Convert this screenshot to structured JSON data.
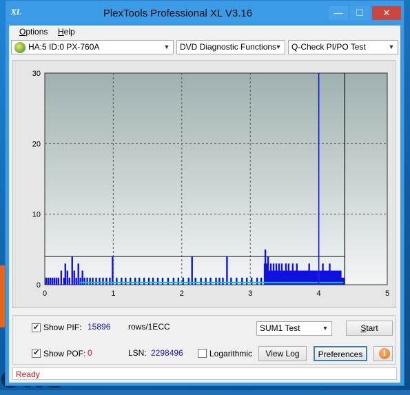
{
  "window": {
    "title": "PlexTools Professional XL V3.16",
    "app_icon": "XL",
    "controls": {
      "minimize": "—",
      "maximize": "☐",
      "close": "✕"
    }
  },
  "menu": {
    "options": {
      "accel": "O",
      "rest": "ptions"
    },
    "help": {
      "accel": "H",
      "rest": "elp"
    }
  },
  "toolbar": {
    "drive": "HA:5 ID:0  PX-760A",
    "function": "DVD Diagnostic Functions",
    "test": "Q-Check PI/PO Test"
  },
  "colors": {
    "pi_series": "#1010e0",
    "po_series": "#00c8c8",
    "plot_top": "#9fb0b0",
    "plot_bottom": "#f4f6f6",
    "status_text": "#e01010"
  },
  "chart_data": {
    "type": "bar",
    "x_ticks": [
      "0",
      "1",
      "2",
      "3",
      "4",
      "5"
    ],
    "y_ticks": [
      "0",
      "10",
      "20",
      "30"
    ],
    "xlim": [
      0,
      5
    ],
    "ylim": [
      0,
      30
    ],
    "grid": true,
    "threshold_line": 4,
    "scan_end_marker": 4.38,
    "highlight_marker": 4.0,
    "series": [
      {
        "points": [
          [
            0.02,
            1
          ],
          [
            0.05,
            1
          ],
          [
            0.08,
            1
          ],
          [
            0.11,
            1
          ],
          [
            0.14,
            1
          ],
          [
            0.17,
            1
          ],
          [
            0.2,
            1
          ],
          [
            0.24,
            2
          ],
          [
            0.28,
            1
          ],
          [
            0.3,
            3
          ],
          [
            0.33,
            2
          ],
          [
            0.36,
            1
          ],
          [
            0.4,
            4
          ],
          [
            0.43,
            2
          ],
          [
            0.46,
            1
          ],
          [
            0.49,
            3
          ],
          [
            0.52,
            1
          ],
          [
            0.55,
            2
          ],
          [
            0.58,
            1
          ],
          [
            0.62,
            1
          ],
          [
            0.66,
            1
          ],
          [
            0.7,
            1
          ],
          [
            0.75,
            1
          ],
          [
            0.8,
            1
          ],
          [
            0.85,
            1
          ],
          [
            0.9,
            1
          ],
          [
            0.95,
            1
          ],
          [
            0.99,
            4
          ],
          [
            1.05,
            1
          ],
          [
            1.12,
            1
          ],
          [
            1.18,
            1
          ],
          [
            1.25,
            1
          ],
          [
            1.32,
            1
          ],
          [
            1.38,
            1
          ],
          [
            1.45,
            1
          ],
          [
            1.52,
            1
          ],
          [
            1.58,
            1
          ],
          [
            1.65,
            1
          ],
          [
            1.72,
            1
          ],
          [
            1.8,
            1
          ],
          [
            1.88,
            1
          ],
          [
            1.95,
            1
          ],
          [
            2.02,
            1
          ],
          [
            2.1,
            1
          ],
          [
            2.15,
            4
          ],
          [
            2.2,
            1
          ],
          [
            2.28,
            1
          ],
          [
            2.35,
            1
          ],
          [
            2.42,
            1
          ],
          [
            2.5,
            1
          ],
          [
            2.55,
            1
          ],
          [
            2.6,
            1
          ],
          [
            2.66,
            4
          ],
          [
            2.72,
            1
          ],
          [
            2.8,
            1
          ],
          [
            2.88,
            1
          ],
          [
            2.95,
            1
          ],
          [
            3.02,
            1
          ],
          [
            3.1,
            1
          ],
          [
            3.16,
            1
          ],
          [
            3.21,
            3
          ],
          [
            3.22,
            5
          ],
          [
            3.24,
            3
          ],
          [
            3.26,
            4
          ],
          [
            3.28,
            2
          ],
          [
            3.3,
            3
          ],
          [
            3.32,
            2
          ],
          [
            3.34,
            3
          ],
          [
            3.36,
            2
          ],
          [
            3.38,
            3
          ],
          [
            3.4,
            2
          ],
          [
            3.42,
            3
          ],
          [
            3.44,
            2
          ],
          [
            3.46,
            3
          ],
          [
            3.48,
            2
          ],
          [
            3.5,
            2
          ],
          [
            3.52,
            3
          ],
          [
            3.54,
            2
          ],
          [
            3.56,
            3
          ],
          [
            3.58,
            2
          ],
          [
            3.6,
            2
          ],
          [
            3.62,
            3
          ],
          [
            3.64,
            2
          ],
          [
            3.66,
            2
          ],
          [
            3.68,
            3
          ],
          [
            3.7,
            2
          ],
          [
            3.72,
            2
          ],
          [
            3.74,
            2
          ],
          [
            3.76,
            2
          ],
          [
            3.78,
            2
          ],
          [
            3.8,
            2
          ],
          [
            3.82,
            2
          ],
          [
            3.84,
            2
          ],
          [
            3.86,
            3
          ],
          [
            3.88,
            2
          ],
          [
            3.9,
            2
          ],
          [
            3.92,
            2
          ],
          [
            3.94,
            2
          ],
          [
            3.96,
            2
          ],
          [
            3.98,
            2
          ],
          [
            4.0,
            30
          ],
          [
            4.02,
            2
          ],
          [
            4.04,
            2
          ],
          [
            4.06,
            3
          ],
          [
            4.08,
            2
          ],
          [
            4.1,
            2
          ],
          [
            4.12,
            2
          ],
          [
            4.14,
            2
          ],
          [
            4.16,
            3
          ],
          [
            4.18,
            2
          ],
          [
            4.2,
            2
          ],
          [
            4.22,
            2
          ],
          [
            4.24,
            2
          ],
          [
            4.26,
            2
          ],
          [
            4.28,
            2
          ],
          [
            4.3,
            2
          ],
          [
            4.32,
            2
          ],
          [
            4.34,
            1
          ],
          [
            4.36,
            1
          ]
        ]
      },
      {
        "points": [
          [
            0.5,
            0.3
          ],
          [
            1.0,
            0.3
          ],
          [
            1.5,
            0.3
          ],
          [
            2.0,
            0.3
          ],
          [
            2.5,
            0.3
          ],
          [
            3.0,
            0.3
          ],
          [
            3.2,
            0.3
          ],
          [
            3.6,
            0.3
          ],
          [
            4.0,
            0.3
          ],
          [
            4.36,
            0.3
          ]
        ]
      }
    ]
  },
  "controls": {
    "show_pif_label": "Show PIF:",
    "show_pif_checked": true,
    "pif_value": "15896",
    "pif_unit": "rows/1ECC",
    "show_pof_label": "Show POF:",
    "show_pof_checked": true,
    "pof_value": "0",
    "lsn_label": "LSN:",
    "lsn_value": "2298496",
    "logarithmic_label": "Logarithmic",
    "logarithmic_checked": false,
    "sum_test": "SUM1 Test",
    "start_accel": "S",
    "start_rest": "tart",
    "view_log": "View Log",
    "preferences": "Preferences",
    "info_icon": "i"
  },
  "status": {
    "text": "Ready"
  },
  "desktop": {
    "text": "ows"
  }
}
